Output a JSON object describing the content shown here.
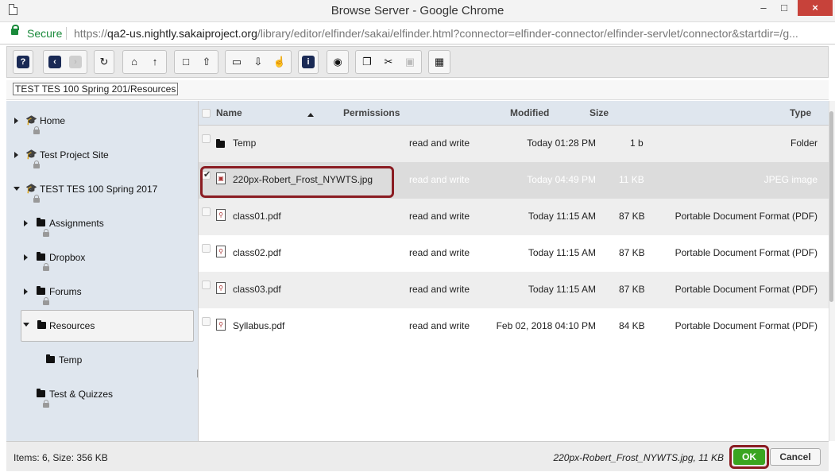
{
  "window": {
    "title": "Browse Server - Google Chrome",
    "minimize": "–",
    "maximize": "□",
    "close": "×"
  },
  "address": {
    "secure_label": "Secure",
    "url_scheme": "https://",
    "url_host": "qa2-us.nightly.sakaiproject.org",
    "url_path": "/library/editor/elfinder/sakai/elfinder.html?connector=elfinder-connector/elfinder-servlet/connector&startdir=/g..."
  },
  "toolbar": {
    "buttons": [
      {
        "name": "help-icon",
        "glyph": "?"
      },
      {
        "name": "back-icon",
        "glyph": "‹"
      },
      {
        "name": "forward-icon",
        "glyph": "›"
      },
      {
        "name": "reload-icon",
        "glyph": "↻"
      },
      {
        "name": "home-icon",
        "glyph": "⌂"
      },
      {
        "name": "up-icon",
        "glyph": "↑"
      },
      {
        "name": "new-folder-icon",
        "glyph": "□"
      },
      {
        "name": "upload-icon",
        "glyph": "⇧"
      },
      {
        "name": "open-icon",
        "glyph": "▭"
      },
      {
        "name": "download-icon",
        "glyph": "⇩"
      },
      {
        "name": "select-icon",
        "glyph": "☝"
      },
      {
        "name": "info-icon",
        "glyph": "i"
      },
      {
        "name": "preview-icon",
        "glyph": "◉"
      },
      {
        "name": "copy-icon",
        "glyph": "❐"
      },
      {
        "name": "cut-icon",
        "glyph": "✂"
      },
      {
        "name": "paste-icon",
        "glyph": "▣"
      },
      {
        "name": "view-icon",
        "glyph": "▦"
      }
    ]
  },
  "path": "TEST TES 100 Spring 201/Resources",
  "tree": {
    "items": [
      {
        "label": "Home"
      },
      {
        "label": "Test Project Site"
      },
      {
        "label": "TEST TES 100 Spring 2017"
      },
      {
        "label": "Assignments"
      },
      {
        "label": "Dropbox"
      },
      {
        "label": "Forums"
      },
      {
        "label": "Resources"
      },
      {
        "label": "Temp"
      },
      {
        "label": "Test & Quizzes"
      }
    ]
  },
  "list": {
    "headers": {
      "name": "Name",
      "permissions": "Permissions",
      "modified": "Modified",
      "size": "Size",
      "type": "Type"
    },
    "rows": [
      {
        "name": "Temp",
        "permissions": "read and write",
        "modified": "Today 01:28 PM",
        "size": "1 b",
        "type": "Folder"
      },
      {
        "name": "220px-Robert_Frost_NYWTS.jpg",
        "permissions": "read and write",
        "modified": "Today 04:49 PM",
        "size": "11 KB",
        "type": "JPEG image"
      },
      {
        "name": "class01.pdf",
        "permissions": "read and write",
        "modified": "Today 11:15 AM",
        "size": "87 KB",
        "type": "Portable Document Format (PDF)"
      },
      {
        "name": "class02.pdf",
        "permissions": "read and write",
        "modified": "Today 11:15 AM",
        "size": "87 KB",
        "type": "Portable Document Format (PDF)"
      },
      {
        "name": "class03.pdf",
        "permissions": "read and write",
        "modified": "Today 11:15 AM",
        "size": "87 KB",
        "type": "Portable Document Format (PDF)"
      },
      {
        "name": "Syllabus.pdf",
        "permissions": "read and write",
        "modified": "Feb 02, 2018 04:10 PM",
        "size": "84 KB",
        "type": "Portable Document Format (PDF)"
      }
    ]
  },
  "status": {
    "left": "Items: 6, Size: 356 KB",
    "right": "220px-Robert_Frost_NYWTS.jpg, 11 KB",
    "ok_label": "OK",
    "cancel_label": "Cancel"
  },
  "colors": {
    "highlight": "#8a1c22",
    "ok_green": "#3aa520",
    "secure_green": "#1a8a3b",
    "close_red": "#c7423a"
  }
}
